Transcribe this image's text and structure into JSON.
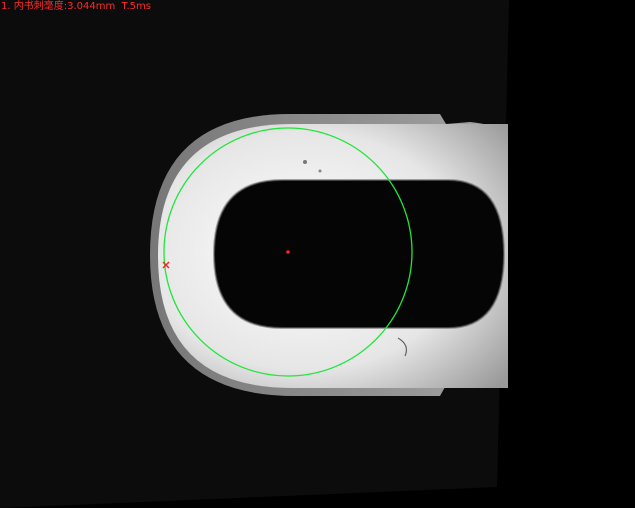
{
  "measurement": {
    "readout": "1. 内书刺毫度:3.044mm  T.5ms"
  },
  "colors": {
    "readout_text": "#ff2a2a",
    "fit_circle": "#1fe63a",
    "center_marker": "#ff2020",
    "edge_marker": "#ff2020",
    "part_bright": "#f4f4f4",
    "part_edge": "#9a9a9a",
    "background": "#000000",
    "shadow_plate": "#0e0e0e"
  }
}
